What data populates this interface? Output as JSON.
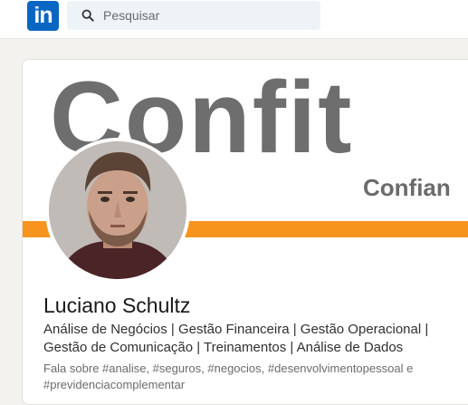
{
  "nav": {
    "logo_text": "in",
    "search_placeholder": "Pesquisar"
  },
  "profile": {
    "banner_word": "Confit",
    "banner_sub": "Confian",
    "name": "Luciano Schultz",
    "headline": "Análise de Negócios | Gestão Financeira | Gestão Operacional | Gestão de Comunicação | Treinamentos | Análise de Dados",
    "about": "Fala sobre #analise, #seguros, #negocios, #desenvolvimentopessoal e #previdenciacomplementar"
  },
  "colors": {
    "brand": "#0a66c2",
    "banner_accent": "#f7941d"
  },
  "icons": {
    "search": "search-icon",
    "avatar": "avatar"
  }
}
